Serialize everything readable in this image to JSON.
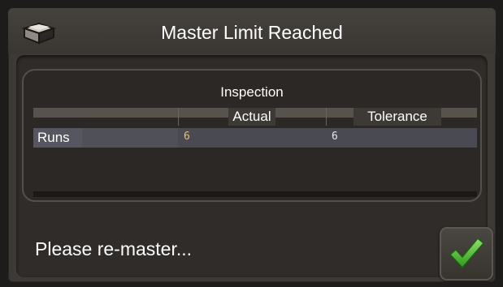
{
  "dialog": {
    "title": "Master Limit Reached",
    "icon": "folder-icon"
  },
  "inspection": {
    "title": "Inspection",
    "columns": [
      "",
      "Actual",
      "Tolerance"
    ],
    "rows": [
      {
        "label": "Runs",
        "actual": "6",
        "tolerance": "6"
      }
    ]
  },
  "message": "Please re-master...",
  "ok_button": {
    "icon": "checkmark-icon",
    "color": "#3fae2a"
  },
  "colors": {
    "actual_value": "#e0c070",
    "tolerance_value": "#e8e8e8"
  }
}
